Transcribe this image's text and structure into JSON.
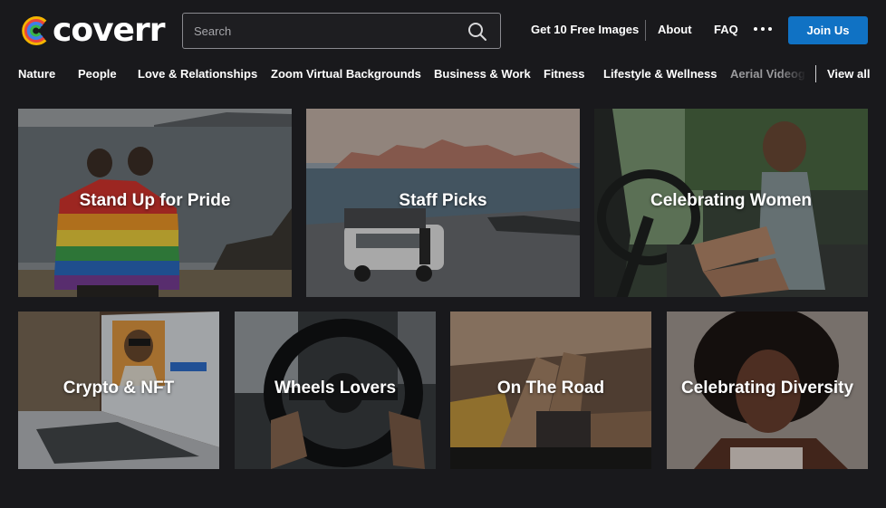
{
  "brand": {
    "name": "coverr",
    "colors": [
      "#f4b400",
      "#e8453c",
      "#3f7fe8",
      "#39b54a"
    ]
  },
  "search": {
    "placeholder": "Search",
    "value": ""
  },
  "nav": {
    "free_images": "Get 10 Free Images",
    "about": "About",
    "faq": "FAQ",
    "more_icon": "more-dots-icon",
    "join": "Join Us"
  },
  "categories": [
    "Nature",
    "People",
    "Love & Relationships",
    "Zoom Virtual Backgrounds",
    "Business & Work",
    "Fitness",
    "Lifestyle & Wellness",
    "Aerial Videog"
  ],
  "view_all": "View all",
  "collections": [
    {
      "title": "Stand Up for Pride"
    },
    {
      "title": "Staff Picks"
    },
    {
      "title": "Celebrating Women"
    },
    {
      "title": "Crypto & NFT"
    },
    {
      "title": "Wheels Lovers"
    },
    {
      "title": "On The Road"
    },
    {
      "title": "Celebrating Diversity"
    }
  ],
  "colors": {
    "background": "#19191c",
    "accent": "#1072c4"
  }
}
